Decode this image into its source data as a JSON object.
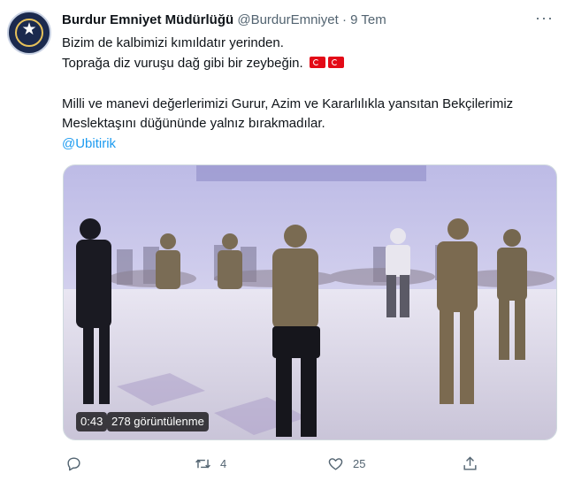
{
  "tweet": {
    "author_name": "Burdur Emniyet Müdürlüğü",
    "author_handle": "@BurdurEmniyet",
    "separator": "·",
    "date": "9 Tem",
    "more_label": "···",
    "lines": [
      "Bizim de kalbimizi kımıldatır yerinden.",
      "Toprağa diz vuruşu dağ gibi bir zeybeğin.",
      "Milli ve manevi değerlerimizi Gurur, Azim ve Kararlılıkla yansıtan Bekçilerimiz",
      "Meslektaşını düğününde yalnız bırakmadılar."
    ],
    "mention": "@Ubitirik",
    "flags": [
      "turkey-flag",
      "turkey-flag"
    ]
  },
  "video": {
    "duration": "0:43",
    "views": "278 görüntülenme"
  },
  "actions": {
    "reply_icon": "reply-icon",
    "retweet_icon": "retweet-icon",
    "retweet_count": "4",
    "like_icon": "heart-icon",
    "like_count": "25",
    "share_icon": "share-icon"
  },
  "colors": {
    "text": "#0f1419",
    "secondary": "#536471",
    "link": "#1d9bf0",
    "flag_red": "#e30a17"
  }
}
